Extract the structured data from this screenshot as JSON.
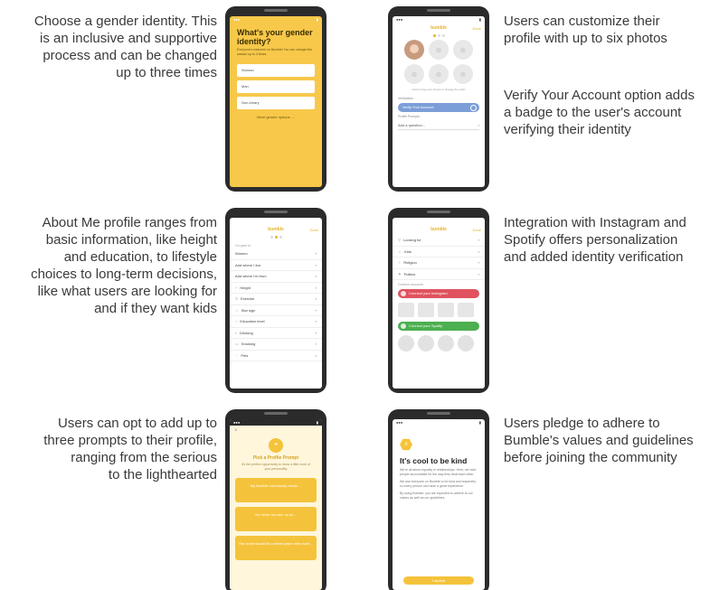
{
  "captions": {
    "c1": [
      "Choose a gender identity. This",
      "is an inclusive and supportive",
      "process and can be changed",
      "up to three times"
    ],
    "c2a": [
      "Users can customize their",
      "profile with up to six photos"
    ],
    "c2b": [
      "Verify Your Account option adds",
      "a badge to the user's account",
      "verifying their identity"
    ],
    "c3": [
      "About Me profile ranges from",
      "basic information, like height",
      "and education, to lifestyle",
      "choices to long-term decisions,",
      "like what users are looking for",
      "and if they want kids"
    ],
    "c4": [
      "Integration with Instagram and",
      "Spotify offers personalization",
      "and added identity verification"
    ],
    "c5": [
      "Users can opt to add up to",
      "three prompts to their profile,",
      "ranging from the serious",
      "to the lighthearted"
    ],
    "c6": [
      "Users pledge to adhere to",
      "Bumble's values and guidelines",
      "before joining the community"
    ]
  },
  "phone1": {
    "title": "What's your gender identity?",
    "sub": "Everyone's welcome on Bumble! You can change this answer up to 3 times.",
    "options": [
      "Woman",
      "Man",
      "Non-binary"
    ],
    "more": "More gender options →"
  },
  "phone2": {
    "brand": "bumble",
    "done": "Done",
    "hint": "Hold & drag your photos to change the order",
    "verify_section": "Verification",
    "verify_label": "Verify Your Account",
    "prompts_section": "Profile Prompts",
    "add_question": "Add a question..."
  },
  "phone3": {
    "brand": "bumble",
    "done": "Done",
    "section": "I'm open to",
    "rows": [
      "Women",
      "Add where I live",
      "Add where I'm from"
    ],
    "basics": [
      "Height",
      "Exercise",
      "Star sign",
      "Education level",
      "Drinking",
      "Smoking",
      "Pets"
    ]
  },
  "phone4": {
    "brand": "bumble",
    "done": "Done",
    "rows": [
      "Looking for",
      "Kids",
      "Religion",
      "Politics"
    ],
    "connect_section": "Connect accounts",
    "instagram": "Connect your Instagram",
    "spotify": "Connect your Spotify"
  },
  "phone5": {
    "close": "×",
    "title": "Pick a Profile Prompt",
    "sub": "It's the perfect opportunity to show a little more of your personality",
    "prompts": [
      "My Bumble community needs…",
      "It's never too late, so at…",
      "The world would be a better place with more…"
    ]
  },
  "phone6": {
    "title": "It's cool to be kind",
    "p1": "We're all about equality in relationships. Here, we hold people accountable for the way they treat each other.",
    "p2": "We ask everyone on Bumble to be kind and respectful, so every person can have a great experience.",
    "p3": "By using Bumble, you are expected to adhere to our values as well as our guidelines.",
    "button": "I accept"
  }
}
